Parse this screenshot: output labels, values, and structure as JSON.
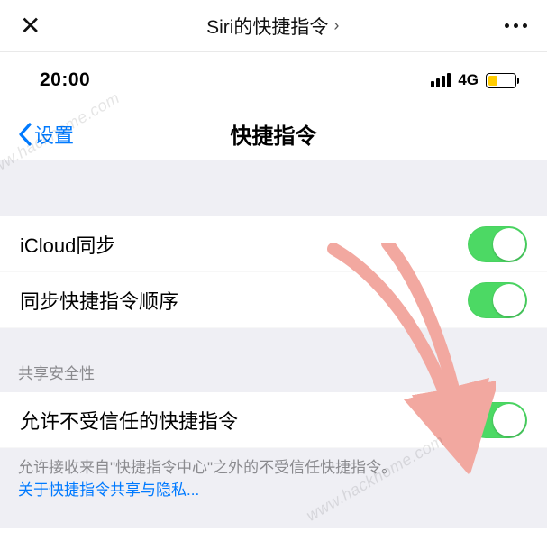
{
  "appbar": {
    "title": "Siri的快捷指令"
  },
  "statusbar": {
    "time": "20:00",
    "network": "4G",
    "battery_pct": 35
  },
  "nav": {
    "back_label": "设置",
    "page_title": "快捷指令"
  },
  "rows": {
    "icloud_sync": {
      "label": "iCloud同步",
      "on": true
    },
    "sync_order": {
      "label": "同步快捷指令顺序",
      "on": true
    },
    "allow_untrusted": {
      "label": "允许不受信任的快捷指令",
      "on": true
    }
  },
  "sections": {
    "security_header": "共享安全性"
  },
  "footer": {
    "text": "允许接收来自\"快捷指令中心\"之外的不受信任快捷指令。",
    "link": "关于快捷指令共享与隐私..."
  },
  "watermark": "www.hackhome.com",
  "colors": {
    "accent": "#007aff",
    "toggle_on": "#4cd964",
    "battery_fill": "#ffcc00",
    "section_bg": "#efeff4"
  }
}
